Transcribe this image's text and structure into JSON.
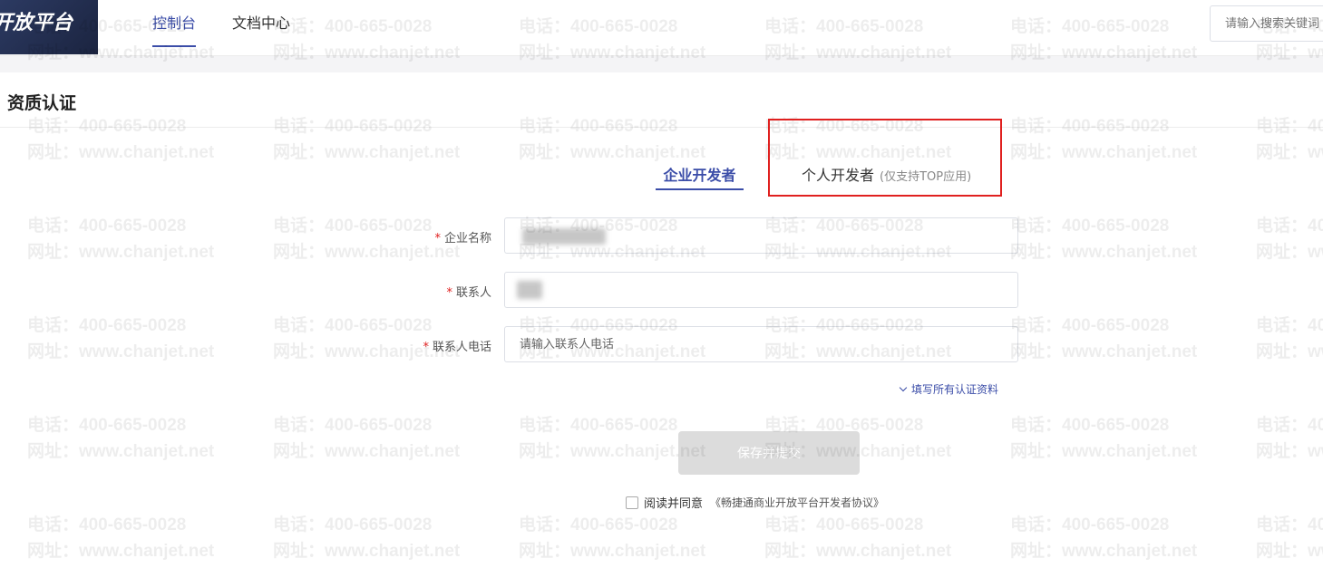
{
  "header": {
    "logo_text": "开放平台",
    "nav": [
      {
        "label": "控制台",
        "active": true
      },
      {
        "label": "文档中心",
        "active": false
      }
    ],
    "search_placeholder": "请输入搜索关键词"
  },
  "watermark": {
    "line1": "电话：400-665-0028",
    "line2": "网址：www.chanjet.net"
  },
  "page": {
    "title": "资质认证"
  },
  "tabs": {
    "enterprise": "企业开发者",
    "personal": "个人开发者",
    "personal_note": "(仅支持TOP应用)"
  },
  "form": {
    "company_name": {
      "label": "企业名称",
      "required": true,
      "value": "",
      "obscured": true
    },
    "contact": {
      "label": "联系人",
      "required": true,
      "value": "",
      "obscured": true
    },
    "contact_phone": {
      "label": "联系人电话",
      "required": true,
      "value": "",
      "placeholder": "请输入联系人电话"
    },
    "expand_link": "填写所有认证资料",
    "submit_label": "保存并提交",
    "agree_text": "阅读并同意",
    "agreement_link": "《畅捷通商业开放平台开发者协议》"
  },
  "colors": {
    "accent": "#3b4da8",
    "required": "#e0201f",
    "highlight": "#e0201f",
    "logo_bg": "#1b2440",
    "disabled_button": "#dcdcdc"
  }
}
